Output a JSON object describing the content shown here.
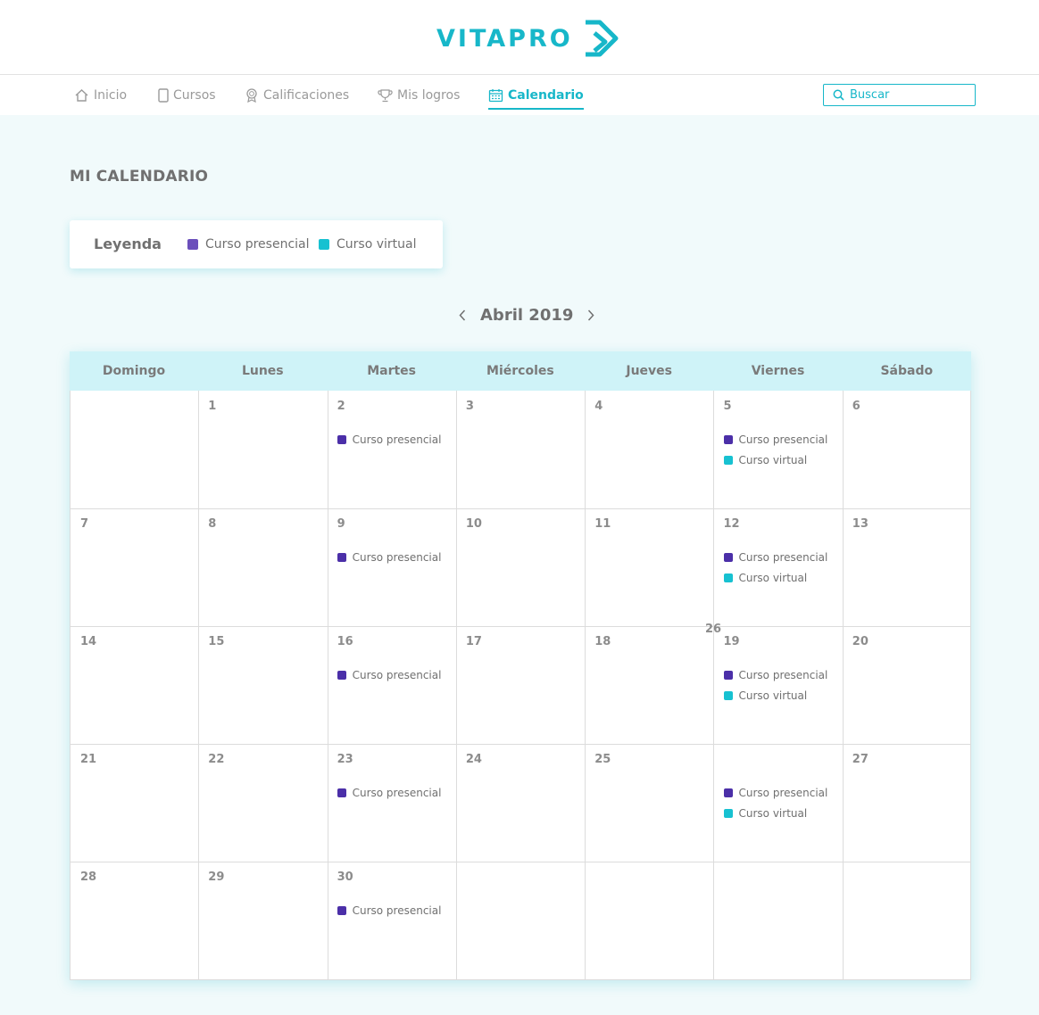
{
  "brand": {
    "name": "VITAPRO",
    "color": "#17b7c9"
  },
  "nav": {
    "items": [
      {
        "label": "Inicio",
        "icon": "home-icon",
        "active": false
      },
      {
        "label": "Cursos",
        "icon": "tablet-icon",
        "active": false
      },
      {
        "label": "Calificaciones",
        "icon": "award-icon",
        "active": false
      },
      {
        "label": "Mis logros",
        "icon": "trophy-icon",
        "active": false
      },
      {
        "label": "Calendario",
        "icon": "calendar-icon",
        "active": true
      }
    ],
    "search_placeholder": "Buscar"
  },
  "page_title": "MI CALENDARIO",
  "legend": {
    "title": "Leyenda",
    "items": [
      {
        "label": "Curso presencial",
        "color": "#6b4fbb"
      },
      {
        "label": "Curso virtual",
        "color": "#17c1d1"
      }
    ]
  },
  "month": {
    "label": "Abril 2019",
    "prev_icon": "chevron-left-icon",
    "next_icon": "chevron-right-icon"
  },
  "calendar": {
    "weekdays": [
      "Domingo",
      "Lunes",
      "Martes",
      "Miércoles",
      "Jueves",
      "Viernes",
      "Sábado"
    ],
    "event_colors": {
      "presencial": "#4b2fa8",
      "virtual": "#17c1d1"
    },
    "weeks": [
      [
        {
          "day": ""
        },
        {
          "day": "1"
        },
        {
          "day": "2",
          "events": [
            "presencial"
          ]
        },
        {
          "day": "3"
        },
        {
          "day": "4"
        },
        {
          "day": "5",
          "events": [
            "presencial",
            "virtual"
          ]
        },
        {
          "day": "6"
        }
      ],
      [
        {
          "day": "7"
        },
        {
          "day": "8"
        },
        {
          "day": "9",
          "events": [
            "presencial"
          ]
        },
        {
          "day": "10"
        },
        {
          "day": "11"
        },
        {
          "day": "12",
          "events": [
            "presencial",
            "virtual"
          ]
        },
        {
          "day": "13"
        }
      ],
      [
        {
          "day": "14"
        },
        {
          "day": "15"
        },
        {
          "day": "16",
          "events": [
            "presencial"
          ]
        },
        {
          "day": "17"
        },
        {
          "day": "18"
        },
        {
          "day": "19",
          "events": [
            "presencial",
            "virtual"
          ]
        },
        {
          "day": "20"
        }
      ],
      [
        {
          "day": "21"
        },
        {
          "day": "22"
        },
        {
          "day": "23",
          "events": [
            "presencial"
          ]
        },
        {
          "day": "24"
        },
        {
          "day": "25"
        },
        {
          "day": "",
          "events": [
            "presencial",
            "virtual"
          ]
        },
        {
          "day": "27"
        }
      ],
      [
        {
          "day": "28"
        },
        {
          "day": "29"
        },
        {
          "day": "30",
          "events": [
            "presencial"
          ]
        },
        {
          "day": ""
        },
        {
          "day": ""
        },
        {
          "day": ""
        },
        {
          "day": ""
        }
      ]
    ],
    "event_labels": {
      "presencial": "Curso presencial",
      "virtual": "Curso virtual"
    },
    "stray_daynum": "26"
  }
}
